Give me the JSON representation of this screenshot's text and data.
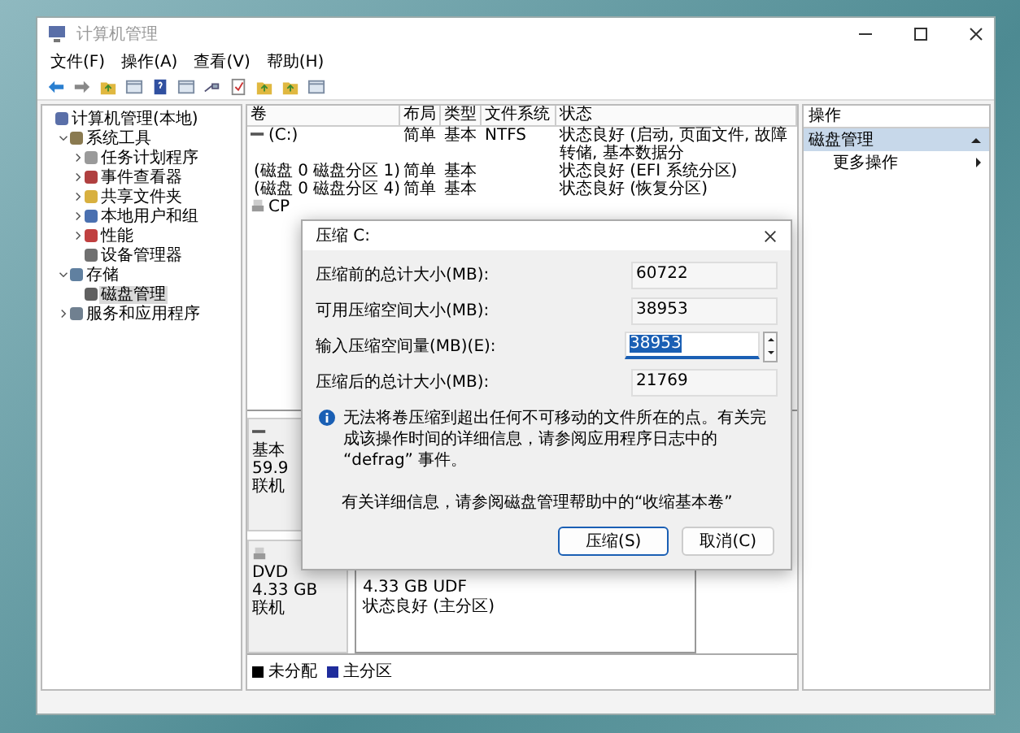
{
  "window": {
    "title": "计算机管理"
  },
  "menu": [
    "文件(F)",
    "操作(A)",
    "查看(V)",
    "帮助(H)"
  ],
  "tree": [
    {
      "label": "计算机管理(本地)",
      "kind": "computer",
      "selected": false,
      "children": [
        {
          "label": "系统工具",
          "kind": "tools",
          "expanded": true,
          "selected": false,
          "children": [
            {
              "label": "任务计划程序",
              "kind": "clock",
              "expanded": false,
              "selected": false
            },
            {
              "label": "事件查看器",
              "kind": "log",
              "expanded": false,
              "selected": false
            },
            {
              "label": "共享文件夹",
              "kind": "folder",
              "expanded": false,
              "selected": false
            },
            {
              "label": "本地用户和组",
              "kind": "users",
              "expanded": false,
              "selected": false
            },
            {
              "label": "性能",
              "kind": "gauge",
              "expanded": false,
              "selected": false
            },
            {
              "label": "设备管理器",
              "kind": "device",
              "selected": false
            }
          ]
        },
        {
          "label": "存储",
          "kind": "storage",
          "expanded": true,
          "selected": false,
          "children": [
            {
              "label": "磁盘管理",
              "kind": "disk",
              "selected": true
            }
          ]
        },
        {
          "label": "服务和应用程序",
          "kind": "services",
          "expanded": false,
          "selected": false
        }
      ]
    }
  ],
  "volumes": {
    "columns": [
      "卷",
      "布局",
      "类型",
      "文件系统",
      "状态"
    ],
    "rows": [
      {
        "kind": "disk",
        "cells": [
          "(C:)",
          "简单",
          "基本",
          "NTFS",
          "状态良好 (启动, 页面文件, 故障转储, 基本数据分"
        ]
      },
      {
        "kind": "disk",
        "cells": [
          "(磁盘 0 磁盘分区 1)",
          "简单",
          "基本",
          "",
          "状态良好 (EFI 系统分区)"
        ]
      },
      {
        "kind": "disk",
        "cells": [
          "(磁盘 0 磁盘分区 4)",
          "简单",
          "基本",
          "",
          "状态良好 (恢复分区)"
        ]
      },
      {
        "kind": "cdrom",
        "cells": [
          "CP"
        ]
      }
    ]
  },
  "disks": [
    {
      "kind": "disk",
      "info": [
        "基本",
        "59.9",
        "联机"
      ],
      "partitions": [
        {
          "kind": "primary"
        }
      ]
    },
    {
      "kind": "cdrom",
      "info": [
        "DVD",
        "4.33 GB",
        "联机"
      ],
      "partitions": [
        {
          "kind": "primary",
          "lines": [
            "4.33 GB UDF",
            "状态良好 (主分区)"
          ]
        }
      ]
    }
  ],
  "legend": [
    {
      "label": "未分配",
      "color": "#000000"
    },
    {
      "label": "主分区",
      "color": "#1f2c9c"
    }
  ],
  "actions": {
    "header": "操作",
    "items": [
      {
        "label": "磁盘管理",
        "kind": "section",
        "selected": true
      },
      {
        "label": "更多操作",
        "kind": "item",
        "selected": false
      }
    ]
  },
  "dialog": {
    "title": "压缩 C:",
    "fields": [
      {
        "label": "压缩前的总计大小(MB):",
        "value": "60722",
        "kind": "readonly"
      },
      {
        "label": "可用压缩空间大小(MB):",
        "value": "38953",
        "kind": "readonly"
      },
      {
        "label": "输入压缩空间量(MB)(E):",
        "value": "38953",
        "kind": "spin"
      },
      {
        "label": "压缩后的总计大小(MB):",
        "value": "21769",
        "kind": "readonly"
      }
    ],
    "info": "无法将卷压缩到超出任何不可移动的文件所在的点。有关完成该操作时间的详细信息，请参阅应用程序日志中的 “defrag” 事件。",
    "help": "有关详细信息，请参阅磁盘管理帮助中的“收缩基本卷”",
    "buttons": [
      {
        "label": "压缩(S)",
        "default": true
      },
      {
        "label": "取消(C)",
        "default": false
      }
    ]
  }
}
